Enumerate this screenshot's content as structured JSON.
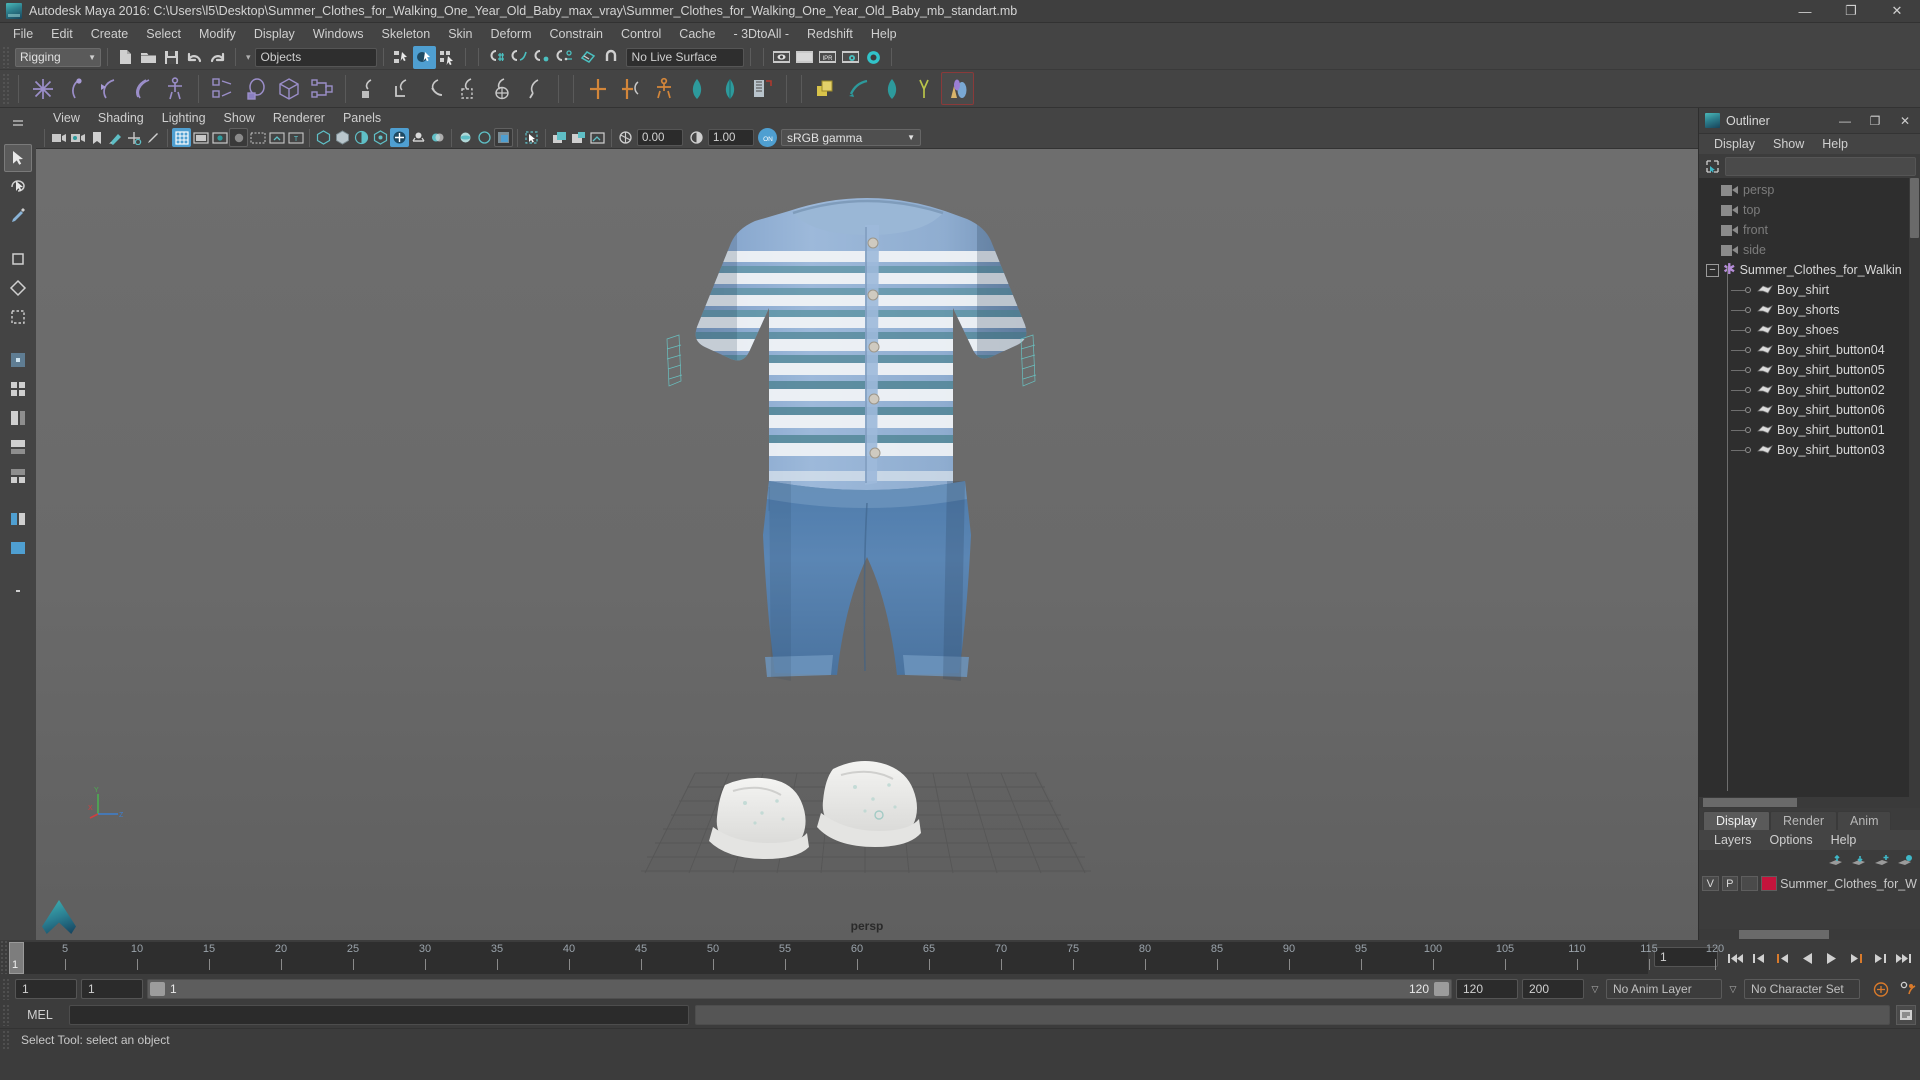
{
  "window": {
    "title": "Autodesk Maya 2016: C:\\Users\\l5\\Desktop\\Summer_Clothes_for_Walking_One_Year_Old_Baby_max_vray\\Summer_Clothes_for_Walking_One_Year_Old_Baby_mb_standart.mb",
    "minimize": "—",
    "maximize": "❐",
    "close": "✕",
    "app_icon": "maya-app-icon"
  },
  "menubar": {
    "items": [
      {
        "label": "File"
      },
      {
        "label": "Edit"
      },
      {
        "label": "Create"
      },
      {
        "label": "Select"
      },
      {
        "label": "Modify"
      },
      {
        "label": "Display"
      },
      {
        "label": "Windows"
      },
      {
        "label": "Skeleton"
      },
      {
        "label": "Skin"
      },
      {
        "label": "Deform"
      },
      {
        "label": "Constrain"
      },
      {
        "label": "Control"
      },
      {
        "label": "Cache"
      },
      {
        "label": "- 3DtoAll -"
      },
      {
        "label": "Redshift"
      },
      {
        "label": "Help"
      }
    ]
  },
  "statusline": {
    "menuset": "Rigging",
    "menuset_arrow": "▼",
    "selection_mask": "Objects",
    "selection_mask_arrow": "▾",
    "live_surface": "No Live Surface",
    "icons": [
      "new-scene-icon",
      "open-scene-icon",
      "save-scene-icon",
      "undo-icon",
      "redo-icon",
      "select-by-hierarchy-icon",
      "select-by-object-icon",
      "select-by-component-icon",
      "snap-to-grid-icon",
      "snap-to-curve-icon",
      "snap-to-point-icon",
      "snap-to-projected-center-icon",
      "snap-to-view-plane-icon",
      "magnet-icon",
      "render-view-icon",
      "render-sequence-icon",
      "ipr-render-icon",
      "render-settings-icon",
      "hypershade-icon"
    ]
  },
  "shelf": {
    "icons": [
      "create-joint-icon",
      "ik-handle-icon",
      "ik-spline-icon",
      "ik-chain-icon",
      "quick-rig-icon",
      "bind-skin-icon",
      "paint-weights-icon",
      "smooth-bind-icon",
      "interactive-bind-icon",
      "parent-constraint-icon",
      "point-constraint-icon",
      "orient-constraint-icon",
      "scale-constraint-icon",
      "aim-constraint-icon",
      "pole-vector-icon",
      "mirror-joint-icon",
      "insert-joint-icon",
      "human-ik-icon",
      "blend-shape-icon",
      "blend-shape-editor-icon",
      "pose-editor-icon",
      "duplicate-special-icon",
      "lattice-icon",
      "cluster-icon",
      "wire-tool-icon",
      "shape-editor-icon"
    ]
  },
  "toolbox": {
    "tools": [
      {
        "name": "select-tool",
        "selected": true
      },
      {
        "name": "lasso-select-tool",
        "selected": false
      },
      {
        "name": "paint-select-tool",
        "selected": false
      },
      {
        "name": "move-tool",
        "selected": false
      },
      {
        "name": "rotate-tool",
        "selected": false
      },
      {
        "name": "scale-tool",
        "selected": false
      },
      {
        "name": "last-tool-used",
        "selected": false
      },
      {
        "name": "single-perspective-layout",
        "selected": false
      },
      {
        "name": "four-view-layout",
        "selected": false
      },
      {
        "name": "persp-outliner-layout",
        "selected": false
      },
      {
        "name": "persp-graph-layout",
        "selected": false
      },
      {
        "name": "persp-hypershade-layout",
        "selected": false
      },
      {
        "name": "two-pane-layout",
        "selected": false
      },
      {
        "name": "more-layouts",
        "selected": false
      }
    ]
  },
  "viewport": {
    "panel_menu": [
      "View",
      "Shading",
      "Lighting",
      "Show",
      "Renderer",
      "Panels"
    ],
    "camera_label": "persp",
    "exposure": "0.00",
    "gamma": "1.00",
    "color_space": "sRGB gamma",
    "color_space_arrow": "▼",
    "toolbar_icons": [
      "select-camera-icon",
      "camera-attributes-icon",
      "bookmark-icon",
      "image-plane-icon",
      "2d-pan-zoom-icon",
      "grease-pencil-icon",
      "grid-toggle-icon",
      "film-gate-icon",
      "resolution-gate-icon",
      "gate-mask-icon",
      "film-origin-icon",
      "xray-icon",
      "xray-joints-icon",
      "wireframe-icon",
      "smooth-shade-icon",
      "shaded-wireframe-icon",
      "textured-icon",
      "use-all-lights-icon",
      "shadows-icon",
      "screen-space-ao-icon",
      "motion-blur-icon",
      "multisample-icon",
      "depth-of-field-icon",
      "isolate-select-icon",
      "xray-active-components-icon",
      "display-resolution-icon",
      "viewport-snapshot-icon",
      "exposure-icon",
      "contrast-icon",
      "view-transform-enabled-icon"
    ],
    "axis_gizmo": {
      "x": "X",
      "y": "Y",
      "z": "Z"
    }
  },
  "outliner": {
    "title": "Outliner",
    "minimize": "—",
    "maximize": "❐",
    "close": "✕",
    "menus": [
      "Display",
      "Show",
      "Help"
    ],
    "search_placeholder": "",
    "items": [
      {
        "label": "persp",
        "type": "camera",
        "depth": 1,
        "dim": true
      },
      {
        "label": "top",
        "type": "camera",
        "depth": 1,
        "dim": true
      },
      {
        "label": "front",
        "type": "camera",
        "depth": 1,
        "dim": true
      },
      {
        "label": "side",
        "type": "camera",
        "depth": 1,
        "dim": true
      },
      {
        "label": "Summer_Clothes_for_Walkin",
        "type": "group",
        "depth": 0,
        "dim": false,
        "expander": "−"
      },
      {
        "label": "Boy_shirt",
        "type": "mesh",
        "depth": 2,
        "dim": false
      },
      {
        "label": "Boy_shorts",
        "type": "mesh",
        "depth": 2,
        "dim": false
      },
      {
        "label": "Boy_shoes",
        "type": "mesh",
        "depth": 2,
        "dim": false
      },
      {
        "label": "Boy_shirt_button04",
        "type": "mesh",
        "depth": 2,
        "dim": false
      },
      {
        "label": "Boy_shirt_button05",
        "type": "mesh",
        "depth": 2,
        "dim": false
      },
      {
        "label": "Boy_shirt_button02",
        "type": "mesh",
        "depth": 2,
        "dim": false
      },
      {
        "label": "Boy_shirt_button06",
        "type": "mesh",
        "depth": 2,
        "dim": false
      },
      {
        "label": "Boy_shirt_button01",
        "type": "mesh",
        "depth": 2,
        "dim": false
      },
      {
        "label": "Boy_shirt_button03",
        "type": "mesh",
        "depth": 2,
        "dim": false
      }
    ]
  },
  "layer_editor": {
    "tabs": [
      {
        "label": "Display",
        "active": true
      },
      {
        "label": "Render",
        "active": false
      },
      {
        "label": "Anim",
        "active": false
      }
    ],
    "menus": [
      "Layers",
      "Options",
      "Help"
    ],
    "toolbar_icons": [
      "move-layer-up-icon",
      "move-layer-down-icon",
      "new-layer-icon",
      "new-layer-from-selected-icon"
    ],
    "layers": [
      {
        "visibility": "V",
        "playback": "P",
        "type": "",
        "color": "#c4143c",
        "name": "Summer_Clothes_for_W"
      }
    ]
  },
  "timeline": {
    "ticks": [
      {
        "value": "5",
        "frame": 5
      },
      {
        "value": "10",
        "frame": 10
      },
      {
        "value": "15",
        "frame": 15
      },
      {
        "value": "20",
        "frame": 20
      },
      {
        "value": "25",
        "frame": 25
      },
      {
        "value": "30",
        "frame": 30
      },
      {
        "value": "35",
        "frame": 35
      },
      {
        "value": "40",
        "frame": 40
      },
      {
        "value": "45",
        "frame": 45
      },
      {
        "value": "50",
        "frame": 50
      },
      {
        "value": "55",
        "frame": 55
      },
      {
        "value": "60",
        "frame": 60
      },
      {
        "value": "65",
        "frame": 65
      },
      {
        "value": "70",
        "frame": 70
      },
      {
        "value": "75",
        "frame": 75
      },
      {
        "value": "80",
        "frame": 80
      },
      {
        "value": "85",
        "frame": 85
      },
      {
        "value": "90",
        "frame": 90
      },
      {
        "value": "95",
        "frame": 95
      },
      {
        "value": "100",
        "frame": 100
      },
      {
        "value": "105",
        "frame": 105
      },
      {
        "value": "110",
        "frame": 110
      },
      {
        "value": "115",
        "frame": 115
      },
      {
        "value": "120",
        "frame": 120
      }
    ],
    "current_frame_marker": "1",
    "current_frame_field": "1",
    "range_start": "1",
    "range_end": "1",
    "slider_start": "1",
    "slider_end": "120",
    "anim_end": "120",
    "playback_end": "200",
    "anim_layer": "No Anim Layer",
    "character_set": "No Character Set",
    "anim_layer_arrow": "▽",
    "character_set_arrow": "▽",
    "playback_icons": [
      "go-to-start-icon",
      "step-back-key-icon",
      "step-back-frame-icon",
      "play-backwards-icon",
      "play-forwards-icon",
      "step-forward-frame-icon",
      "step-forward-key-icon",
      "go-to-end-icon"
    ],
    "extra_icons": [
      "auto-key-icon",
      "animation-preferences-icon"
    ]
  },
  "command_line": {
    "language": "MEL",
    "input_value": "",
    "output_value": "",
    "script-editor-icon": "script-editor-icon"
  },
  "help_line": {
    "text": "Select Tool: select an object"
  },
  "colors": {
    "accent": "#4f9fd1",
    "panel_bg": "#3c3c3c",
    "viewport_bg": "#6a6a6a",
    "tree_bg": "#2e2e2e",
    "layer_swatch": "#c4143c",
    "orange_marker": "#d97a2b"
  }
}
